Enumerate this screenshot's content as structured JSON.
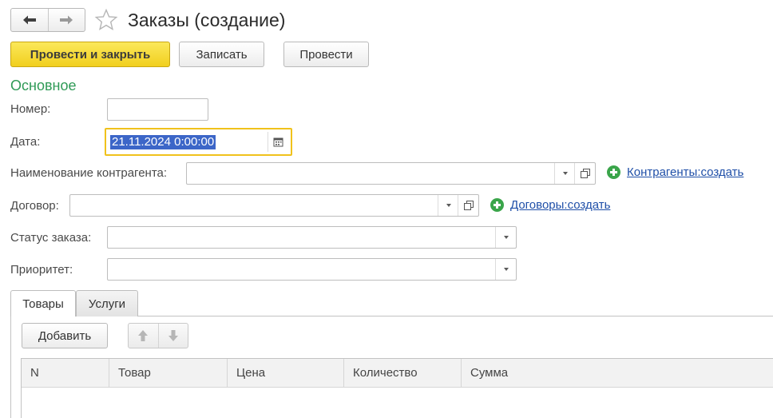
{
  "window": {
    "title": "Заказы (создание)"
  },
  "toolbar": {
    "post_close_label": "Провести и закрыть",
    "save_label": "Записать",
    "post_label": "Провести"
  },
  "section": {
    "title": "Основное"
  },
  "form": {
    "number": {
      "label": "Номер:",
      "value": ""
    },
    "date": {
      "label": "Дата:",
      "value": "21.11.2024  0:00:00"
    },
    "counterparty": {
      "label": "Наименование контрагента:",
      "value": "",
      "create_link": "Контрагенты:создать"
    },
    "contract": {
      "label": "Договор:",
      "value": "",
      "create_link": "Договоры:создать"
    },
    "status": {
      "label": "Статус заказа:",
      "value": ""
    },
    "priority": {
      "label": "Приоритет:",
      "value": ""
    }
  },
  "tabs": [
    {
      "label": "Товары",
      "active": true
    },
    {
      "label": "Услуги",
      "active": false
    }
  ],
  "goods_panel": {
    "add_label": "Добавить",
    "columns": [
      "N",
      "Товар",
      "Цена",
      "Количество",
      "Сумма"
    ],
    "rows": []
  },
  "icons": {
    "back": "arrow-left-icon",
    "forward": "arrow-right-icon",
    "favorite": "star-icon",
    "calendar": "calendar-icon",
    "dropdown": "chevron-down-icon",
    "open": "open-form-icon",
    "create": "plus-circle-icon",
    "move_up": "arrow-up-icon",
    "move_down": "arrow-down-icon"
  },
  "colors": {
    "primary_button": "#f5d83a",
    "section_title": "#2f9a56",
    "link": "#1f4fa8",
    "active_field_border": "#f0c21c",
    "text_selection": "#3c66c8"
  }
}
